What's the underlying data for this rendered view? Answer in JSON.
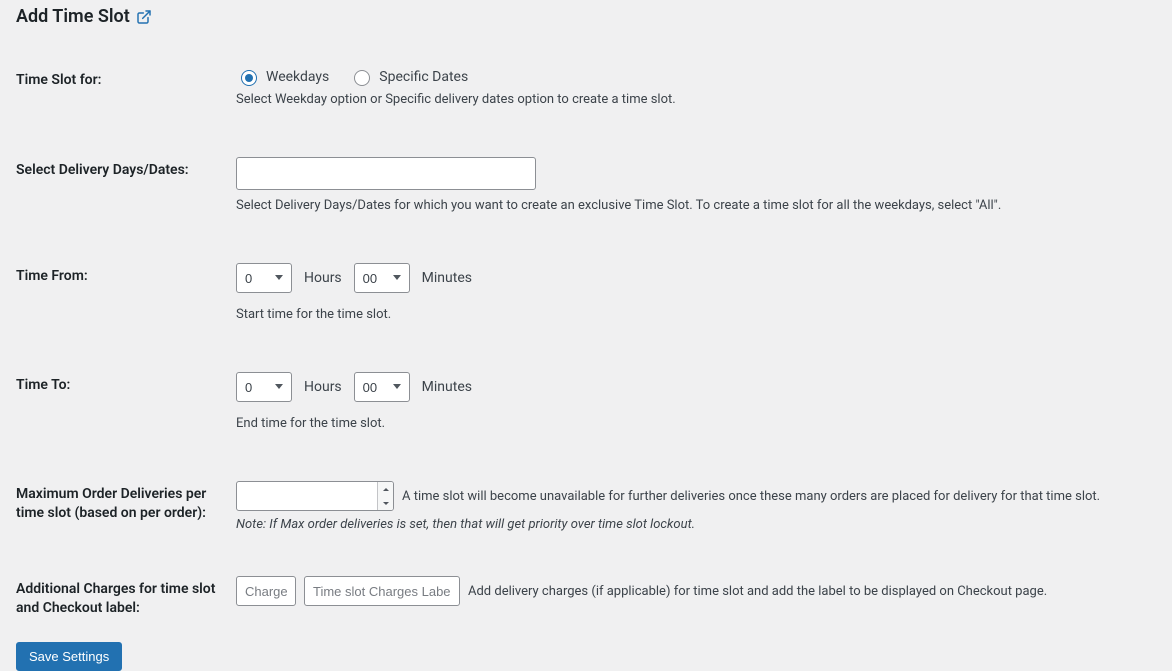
{
  "heading": "Add Time Slot",
  "fields": {
    "slot_for": {
      "label": "Time Slot for:",
      "opt_weekdays": "Weekdays",
      "opt_specific": "Specific Dates",
      "desc": "Select Weekday option or Specific delivery dates option to create a time slot."
    },
    "select_days": {
      "label": "Select Delivery Days/Dates:",
      "desc": "Select Delivery Days/Dates for which you want to create an exclusive Time Slot. To create a time slot for all the weekdays, select \"All\"."
    },
    "time_from": {
      "label": "Time From:",
      "hours_value": "0",
      "hours_unit": "Hours",
      "mins_value": "00",
      "mins_unit": "Minutes",
      "desc": "Start time for the time slot."
    },
    "time_to": {
      "label": "Time To:",
      "hours_value": "0",
      "hours_unit": "Hours",
      "mins_value": "00",
      "mins_unit": "Minutes",
      "desc": "End time for the time slot."
    },
    "max_orders": {
      "label": "Maximum Order Deliveries per time slot (based on per order):",
      "value": "",
      "desc": "A time slot will become unavailable for further deliveries once these many orders are placed for delivery for that time slot.",
      "note": "Note: If Max order deliveries is set, then that will get priority over time slot lockout."
    },
    "charges": {
      "label": "Additional Charges for time slot and Checkout label:",
      "placeholder_charges": "Charges",
      "placeholder_label": "Time slot Charges Label",
      "desc": "Add delivery charges (if applicable) for time slot and add the label to be displayed on Checkout page."
    }
  },
  "submit_label": "Save Settings"
}
